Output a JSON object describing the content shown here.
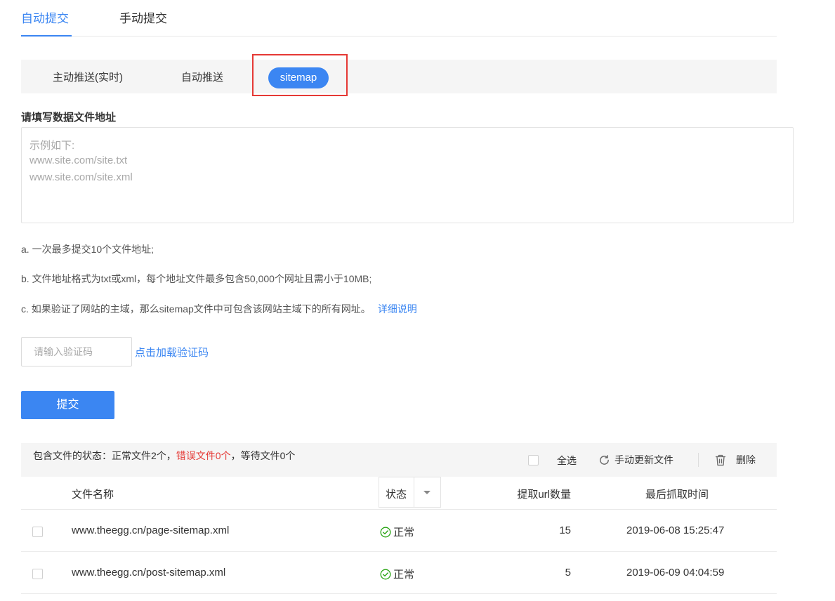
{
  "top_tabs": [
    {
      "label": "自动提交"
    },
    {
      "label": "手动提交"
    }
  ],
  "sub_tabs": [
    {
      "label": "主动推送(实时)"
    },
    {
      "label": "自动推送"
    },
    {
      "label": "sitemap"
    }
  ],
  "form": {
    "section_label": "请填写数据文件地址",
    "placeholder_lines": [
      "示例如下:",
      "www.site.com/site.txt",
      "www.site.com/site.xml"
    ],
    "notes": {
      "a": "a. 一次最多提交10个文件地址;",
      "b": "b. 文件地址格式为txt或xml，每个地址文件最多包含50,000个网址且需小于10MB;",
      "c": "c. 如果验证了网站的主域，那么sitemap文件中可包含该网站主域下的所有网址。",
      "c_link": "详细说明"
    },
    "captcha_placeholder": "请输入验证码",
    "captcha_link": "点击加载验证码",
    "submit_label": "提交"
  },
  "status_bar": {
    "prefix": "包含文件的状态：正常文件2个，",
    "error_part": "错误文件0个",
    "suffix": "，等待文件0个",
    "select_all": "全选",
    "refresh": "手动更新文件",
    "delete": "删除"
  },
  "table": {
    "headers": {
      "name": "文件名称",
      "status": "状态",
      "count": "提取url数量",
      "time": "最后抓取时间"
    },
    "rows": [
      {
        "name": "www.theegg.cn/page-sitemap.xml",
        "status": "正常",
        "count": "15",
        "time": "2019-06-08 15:25:47"
      },
      {
        "name": "www.theegg.cn/post-sitemap.xml",
        "status": "正常",
        "count": "5",
        "time": "2019-06-09 04:04:59"
      }
    ]
  },
  "colors": {
    "accent": "#3b86f2",
    "error": "#e53935",
    "ok": "#2aa515",
    "highlight_box": "#e53935"
  }
}
